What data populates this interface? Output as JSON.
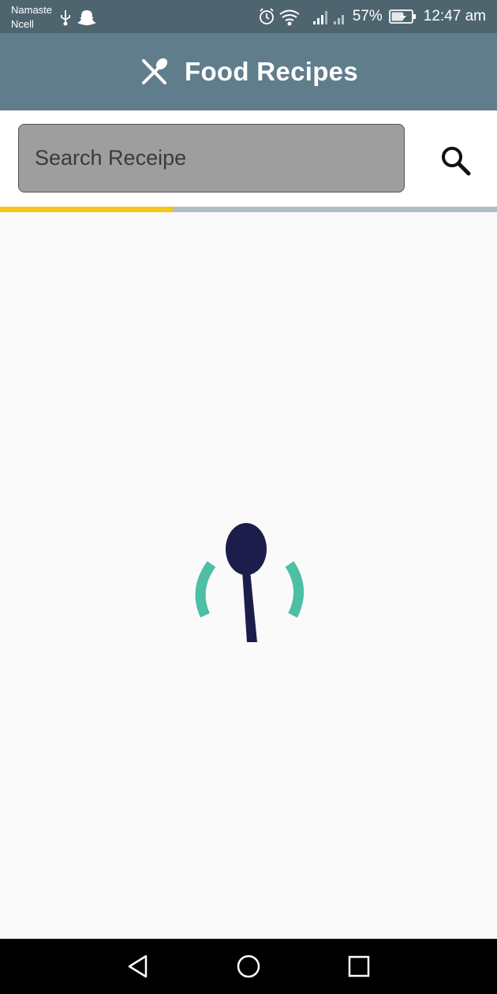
{
  "status_bar": {
    "carrier_line1": "Namaste",
    "carrier_line2": "Ncell",
    "battery": "57%",
    "time": "12:47 am",
    "icons_left": [
      "usb-icon",
      "snapchat-icon"
    ],
    "icons_right": [
      "alarm-icon",
      "wifi-icon",
      "signal-icon",
      "signal-icon",
      "battery-icon"
    ]
  },
  "app_bar": {
    "title": "Food Recipes",
    "icon": "utensils-icon"
  },
  "search": {
    "placeholder": "Search Receipe",
    "value": "",
    "button_icon": "search-icon"
  },
  "progress": {
    "fraction": 0.347,
    "fill_color": "#f5c518",
    "track_color": "#b0bec5"
  },
  "loader": {
    "icon": "spoon-icon",
    "spoon_color": "#1c1d4a",
    "arc_color": "#4dbfa3"
  },
  "nav_bar": {
    "buttons": [
      "back-icon",
      "home-icon",
      "recents-icon"
    ]
  },
  "colors": {
    "status_bar": "#4e6570",
    "app_bar": "#607d8b",
    "background": "#fafafa",
    "search_field": "#9e9e9e"
  }
}
